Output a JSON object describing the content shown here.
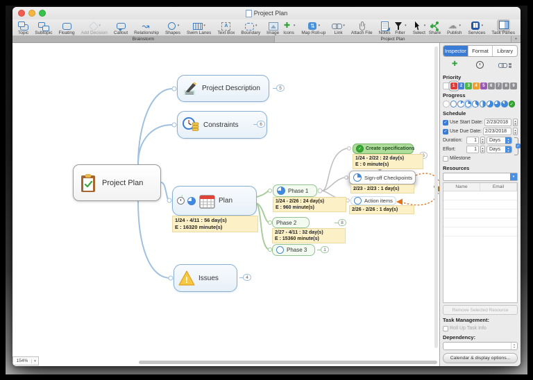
{
  "window": {
    "title": "Project Plan"
  },
  "status": {
    "zoom": "154%"
  },
  "toolbar": {
    "groups": [
      {
        "items": [
          {
            "label": "Topic",
            "icon": "topic-icon"
          },
          {
            "label": "Subtopic",
            "icon": "subtopic-icon"
          },
          {
            "label": "Floating",
            "icon": "floating-icon"
          },
          {
            "label": "Add Decision",
            "icon": "add-decision-icon",
            "dropdown": true,
            "disabled": true
          },
          {
            "label": "Callout",
            "icon": "callout-icon"
          },
          {
            "label": "Relationship",
            "icon": "relationship-icon"
          },
          {
            "label": "Shapes",
            "icon": "shapes-icon",
            "dropdown": true
          },
          {
            "label": "Swim Lanes",
            "icon": "swim-lanes-icon",
            "dropdown": true
          },
          {
            "label": "Text Box",
            "icon": "text-box-icon"
          },
          {
            "label": "Boundary",
            "icon": "boundary-icon",
            "dropdown": true
          },
          {
            "label": "Image",
            "icon": "image-icon"
          }
        ]
      },
      {
        "items": [
          {
            "label": "Icons",
            "icon": "icons-icon",
            "dropdown": true
          },
          {
            "label": "Map Roll-up",
            "icon": "map-roll-up-icon",
            "dropdown": true
          },
          {
            "label": "Link",
            "icon": "link-icon",
            "dropdown": true
          },
          {
            "label": "Attach File",
            "icon": "attach-file-icon"
          },
          {
            "label": "Notes",
            "icon": "notes-icon"
          }
        ]
      },
      {
        "items": [
          {
            "label": "Filter",
            "icon": "filter-icon",
            "dropdown": true
          },
          {
            "label": "Select",
            "icon": "select-icon",
            "dropdown": true
          }
        ]
      },
      {
        "items": [
          {
            "label": "Share",
            "icon": "share-icon"
          },
          {
            "label": "Publish",
            "icon": "publish-icon",
            "dropdown": true
          },
          {
            "label": "Services",
            "icon": "services-icon",
            "dropdown": true
          },
          {
            "label": "Task Panes",
            "icon": "task-panes-icon",
            "highlighted": true
          }
        ]
      }
    ]
  },
  "tabbar": {
    "tabs": [
      {
        "label": "Brainstorm"
      },
      {
        "label": "Project Plan",
        "active": true
      }
    ],
    "add_button": "+"
  },
  "map": {
    "colors": {
      "blue": "#a0c0e0",
      "green": "#a8cc9e",
      "gray": "#bcbcbc",
      "orange": "#e0731c"
    },
    "central": {
      "label": "Project Plan",
      "icon": "clipboard-check-icon"
    },
    "project_description": {
      "label": "Project Description",
      "icon": "pen-icon",
      "badge": "5"
    },
    "constraints": {
      "label": "Constraints",
      "icon": "clock-coins-icon",
      "badge": "6"
    },
    "plan": {
      "label": "Plan",
      "icon": "calendar-icon",
      "note_line1": "1/24 - 4/11 : 56 day(s)",
      "note_line2": "E : 16320 minute(s)"
    },
    "issues": {
      "label": "Issues",
      "icon": "warning-icon",
      "badge": "4"
    },
    "phase1": {
      "label": "Phase 1",
      "icon": "progress-75-icon",
      "note_line1": "1/24 - 2/26 : 24 day(s)",
      "note_line2": "E : 960 minute(s)"
    },
    "phase2": {
      "label": "Phase 2",
      "badge": "8",
      "note_line1": "2/27 - 4/11 : 32 day(s)",
      "note_line2": "E : 15360 minute(s)"
    },
    "phase3": {
      "label": "Phase 3",
      "icon": "progress-0-icon",
      "badge": "1"
    },
    "create_specifications": {
      "label": "Create specifications",
      "icon": "check-circle-icon",
      "badge": "6",
      "note_line1": "1/24 - 2/22 : 22 day(s)",
      "note_line2": "E : 0 minute(s)"
    },
    "signoff": {
      "label": "Sign-off Checkpoints",
      "icon": "progress-25-icon",
      "note_line1": "2/23 - 2/23 : 1 day(s)"
    },
    "action_items": {
      "label": "Action items",
      "icon": "progress-0-icon",
      "note_line1": "2/26 - 2/26 : 1 day(s)"
    }
  },
  "inspector": {
    "tabs": [
      {
        "label": "Inspector",
        "active": true
      },
      {
        "label": "Format"
      },
      {
        "label": "Library"
      }
    ],
    "pane_icons": [
      {
        "icon": "add-task-icon"
      },
      {
        "icon": "clock-icon"
      },
      {
        "icon": "link-paperclip-icon"
      }
    ],
    "priority": {
      "label": "Priority",
      "items": [
        {
          "n": "",
          "color": "#ffffff"
        },
        {
          "n": "1",
          "color": "#e03c39",
          "selected": true
        },
        {
          "n": "2",
          "color": "#4a7fd4"
        },
        {
          "n": "3",
          "color": "#50b648"
        },
        {
          "n": "4",
          "color": "#f09f2e"
        },
        {
          "n": "5",
          "color": "#9b59b6"
        },
        {
          "n": "6",
          "color": "#8e8e93"
        },
        {
          "n": "7",
          "color": "#8e8e93"
        },
        {
          "n": "8",
          "color": "#8e8e93"
        },
        {
          "n": "9",
          "color": "#8e8e93"
        }
      ]
    },
    "progress": {
      "label": "Progress",
      "accent": "#3f8ae0",
      "done_color": "#34a832",
      "check_glyph": "✓",
      "items": [
        {
          "type": "blank"
        },
        {
          "frac": 0
        },
        {
          "frac": 0.125
        },
        {
          "frac": 0.25,
          "selected": true
        },
        {
          "frac": 0.375
        },
        {
          "frac": 0.5
        },
        {
          "frac": 0.625
        },
        {
          "frac": 0.75
        },
        {
          "frac": 0.875
        },
        {
          "type": "check"
        }
      ]
    },
    "schedule": {
      "label": "Schedule",
      "start": {
        "label": "Use Start Date:",
        "checked": true,
        "value": "2/23/2018"
      },
      "due": {
        "label": "Use Due Date:",
        "checked": true,
        "value": "2/23/2018"
      },
      "duration": {
        "label": "Duration:",
        "value": "1",
        "unit": "Days"
      },
      "effort": {
        "label": "Effort:",
        "value": "1",
        "unit": "Days"
      },
      "milestone_label": "Milestone"
    },
    "resources": {
      "label": "Resources",
      "columns": [
        "Name",
        "Email"
      ],
      "remove_button": "Remove Selected Resource"
    },
    "task_management": {
      "label": "Task Management:",
      "rollup_label": "Roll Up Task Info"
    },
    "dependency": {
      "label": "Dependency:"
    },
    "calendar_button": "Calendar & display options..."
  }
}
